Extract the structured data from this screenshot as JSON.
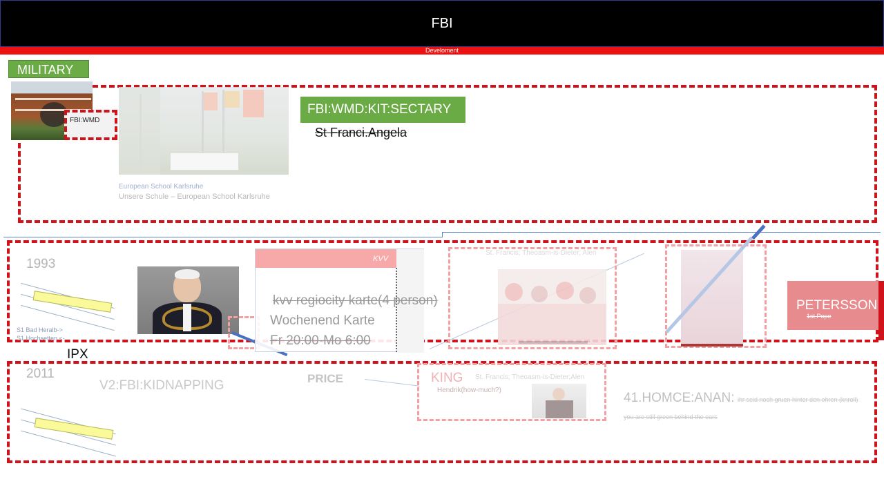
{
  "header": {
    "title": "FBI",
    "subtitle": "Develoment"
  },
  "military_tag": "MILITARY",
  "school": {
    "fbi_wmd_label": "FBI:WMD",
    "caption_source": "European School Karlsruhe",
    "caption_title": "Unsere Schule – European School Karlsruhe",
    "role_tag": "FBI:WMD:KIT:SECTARY",
    "struck_name": "St Franci.Angela"
  },
  "row_1993": {
    "year": "1993",
    "s1_lines": [
      "S1 Bad Heralb->",
      "S1 Hochsetten <-"
    ],
    "kvv_header": "KVV",
    "kvv_line1": "kvv regiocity karte(4 person)",
    "kvv_line2": "Wochenend Karte",
    "kvv_line3": "Fr 20:00-Mo 6:00",
    "faint_caption": "St. Francis; Theoasm-is-Dieter; Alen",
    "petersson_name": "PETERSSON",
    "petersson_sub": "1st Pope"
  },
  "ipx_label": "IPX",
  "row_2011": {
    "year": "2011",
    "kidnapping": "V2:FBI:KIDNAPPING",
    "price": "PRICE",
    "king": "KING",
    "king_caption": "St. Francis; Theoasm-is-Dieter;Alen",
    "king_sub": "Hendrik(how-much?)",
    "homce_prefix": "41.HOMCE:ANAN:",
    "homce_struck": "ihr seid noch gruen hinter den ohren (knroll) you are still green behind the ears"
  },
  "colors": {
    "header_bg": "#000000",
    "accent_red": "#ee1111",
    "dash_red": "#d0121b",
    "tag_green": "#6aab46",
    "petersson_bg": "#e88b8e",
    "kvv_header": "#f7a8a9"
  }
}
